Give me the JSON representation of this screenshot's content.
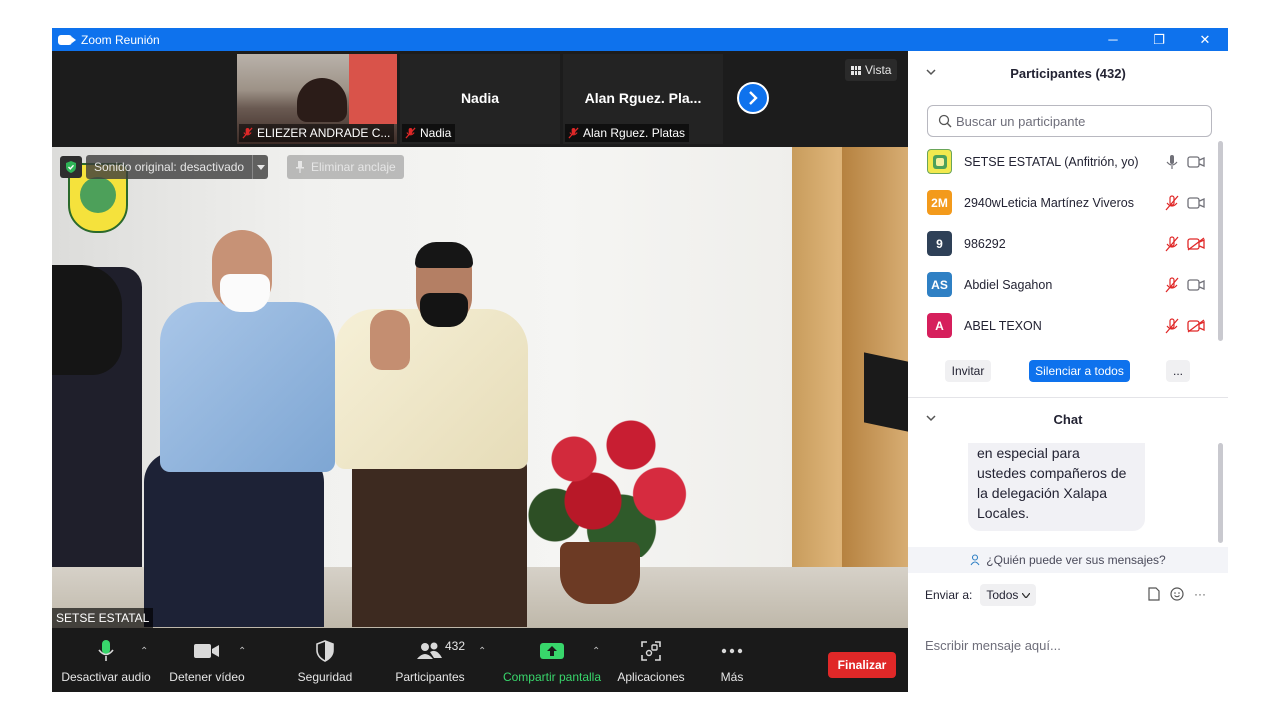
{
  "window": {
    "title": "Zoom Reunión",
    "minimize_glyph": "─",
    "restore_glyph": "❐",
    "close_glyph": "✕"
  },
  "thumbnails": [
    {
      "name": "",
      "label": "ELIEZER ANDRADE C...",
      "muted": true,
      "has_video": true
    },
    {
      "name": "Nadia",
      "label": "Nadia",
      "muted": true,
      "has_video": false
    },
    {
      "name": "Alan  Rguez. Pla...",
      "label": "Alan  Rguez. Platas",
      "muted": true,
      "has_video": false
    }
  ],
  "view_button": {
    "label": "Vista",
    "icon": "grid-icon"
  },
  "main_video": {
    "original_sound_label": "Sonido original: desactivado",
    "unpin_label": "Eliminar anclaje",
    "speaker_name": "SETSE ESTATAL"
  },
  "toolbar": {
    "mute_label": "Desactivar audio",
    "video_label": "Detener vídeo",
    "security_label": "Seguridad",
    "participants_label": "Participantes",
    "participants_count": "432",
    "share_label": "Compartir pantalla",
    "apps_label": "Aplicaciones",
    "more_label": "Más",
    "end_label": "Finalizar"
  },
  "participants_panel": {
    "title": "Participantes (432)",
    "search_placeholder": "Buscar un participante",
    "invite_label": "Invitar",
    "mute_all_label": "Silenciar a todos",
    "more_label": "...",
    "participants": [
      {
        "avatar": "",
        "avatar_color": "#f2e94e",
        "name": "SETSE ESTATAL (Anfitrión, yo)",
        "mic_muted": false,
        "cam_off": false
      },
      {
        "avatar": "2M",
        "avatar_color": "#f39a1b",
        "name": "2940wLeticia Martínez Viveros",
        "mic_muted": true,
        "cam_off": false
      },
      {
        "avatar": "9",
        "avatar_color": "#2e4057",
        "name": "986292",
        "mic_muted": true,
        "cam_off": true
      },
      {
        "avatar": "AS",
        "avatar_color": "#2f80c4",
        "name": "Abdiel Sagahon",
        "mic_muted": true,
        "cam_off": false
      },
      {
        "avatar": "A",
        "avatar_color": "#d61f5c",
        "name": "ABEL TEXON",
        "mic_muted": true,
        "cam_off": true
      }
    ]
  },
  "chat_panel": {
    "title": "Chat",
    "message_lines": [
      "en especial para",
      "ustedes compañeros de",
      "la delegación Xalapa",
      "Locales."
    ],
    "who_can_see": "¿Quién puede ver sus mensajes?",
    "send_to_label": "Enviar a:",
    "send_to_value": "Todos",
    "input_placeholder": "Escribir mensaje aquí...",
    "more_glyph": "···"
  },
  "colors": {
    "accent": "#0e72ed",
    "end_red": "#e02828",
    "share_green": "#38d66b",
    "muted_red": "#e02828"
  }
}
